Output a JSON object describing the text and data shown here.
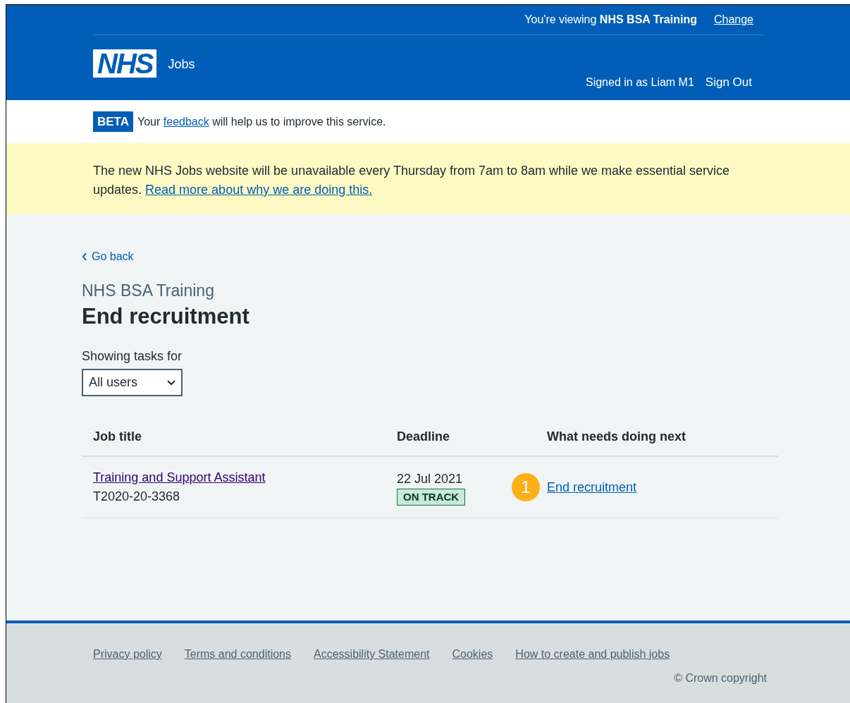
{
  "header": {
    "viewing_prefix": "You're viewing",
    "viewing_org": "NHS BSA Training",
    "change_link": "Change",
    "logo": "NHS",
    "service_name": "Jobs",
    "signed_in": "Signed in as Liam M1",
    "sign_out": "Sign Out"
  },
  "beta_banner": {
    "tag": "BETA",
    "before": "Your",
    "link": "feedback",
    "after": "will help us to improve this service."
  },
  "notice": {
    "text": "The new NHS Jobs website will be unavailable every Thursday from 7am to 8am while we make essential service updates.",
    "link": "Read more about why we are doing this."
  },
  "back_link": "Go back",
  "caption": "NHS BSA Training",
  "heading": "End recruitment",
  "filter": {
    "label": "Showing tasks for",
    "value": "All users"
  },
  "table": {
    "columns": [
      "Job title",
      "Deadline",
      "What needs doing next"
    ],
    "rows": [
      {
        "job_title": "Training and Support Assistant",
        "reference": "T2020-20-3368",
        "deadline": "22 Jul 2021",
        "status": "ON TRACK",
        "step": "1",
        "action": "End recruitment"
      }
    ]
  },
  "footer": {
    "links": [
      "Privacy policy",
      "Terms and conditions",
      "Accessibility Statement",
      "Cookies",
      "How to create and publish jobs"
    ],
    "copyright": "© Crown copyright"
  }
}
